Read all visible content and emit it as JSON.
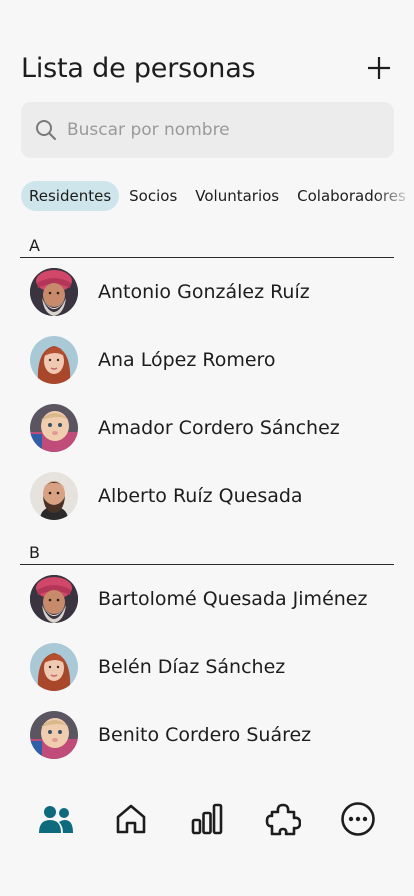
{
  "header": {
    "title": "Lista de personas"
  },
  "search": {
    "placeholder": "Buscar por nombre"
  },
  "filters": [
    "Residentes",
    "Socios",
    "Voluntarios",
    "Colaboradores"
  ],
  "sections": [
    {
      "letter": "A",
      "people": [
        {
          "name": "Antonio González Ruíz",
          "avatar": "elder-man"
        },
        {
          "name": "Ana López Romero",
          "avatar": "red-hair-woman"
        },
        {
          "name": "Amador Cordero Sánchez",
          "avatar": "child"
        },
        {
          "name": "Alberto Ruíz Quesada",
          "avatar": "bearded-man"
        }
      ]
    },
    {
      "letter": "B",
      "people": [
        {
          "name": "Bartolomé Quesada Jiménez",
          "avatar": "elder-man"
        },
        {
          "name": "Belén Díaz Sánchez",
          "avatar": "red-hair-woman"
        },
        {
          "name": "Benito Cordero Suárez",
          "avatar": "child"
        }
      ]
    }
  ],
  "tabbar": [
    "people-icon",
    "home-icon",
    "chart-icon",
    "puzzle-icon",
    "more-icon"
  ],
  "colors": {
    "accent": "#0e6a7d",
    "chip_active": "#cfe5ec",
    "background": "#f7f7f7"
  }
}
